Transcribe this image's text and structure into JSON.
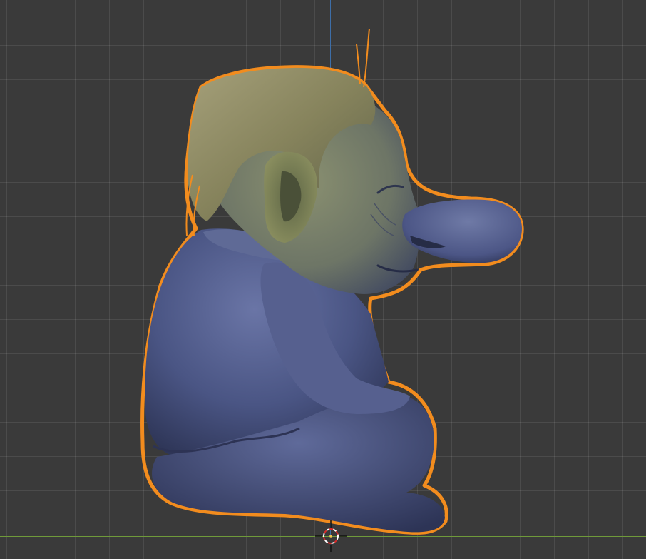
{
  "viewport": {
    "view": "side-orthographic",
    "background_color": "#3a3a3a",
    "grid_color": "#4a4a4a",
    "axis_colors": {
      "z": "#3d6ea8",
      "x": "#6f9a3a"
    }
  },
  "object": {
    "name": "",
    "selected": true,
    "outline_color": "#f28c1e",
    "hair_color": "#8a8a5a",
    "skin_color": "#6e7a6c",
    "clothing_color": "#4a5584"
  },
  "cursor": {
    "icon": "3d-cursor-icon",
    "colors": [
      "#d62a2a",
      "#ffffff"
    ]
  }
}
